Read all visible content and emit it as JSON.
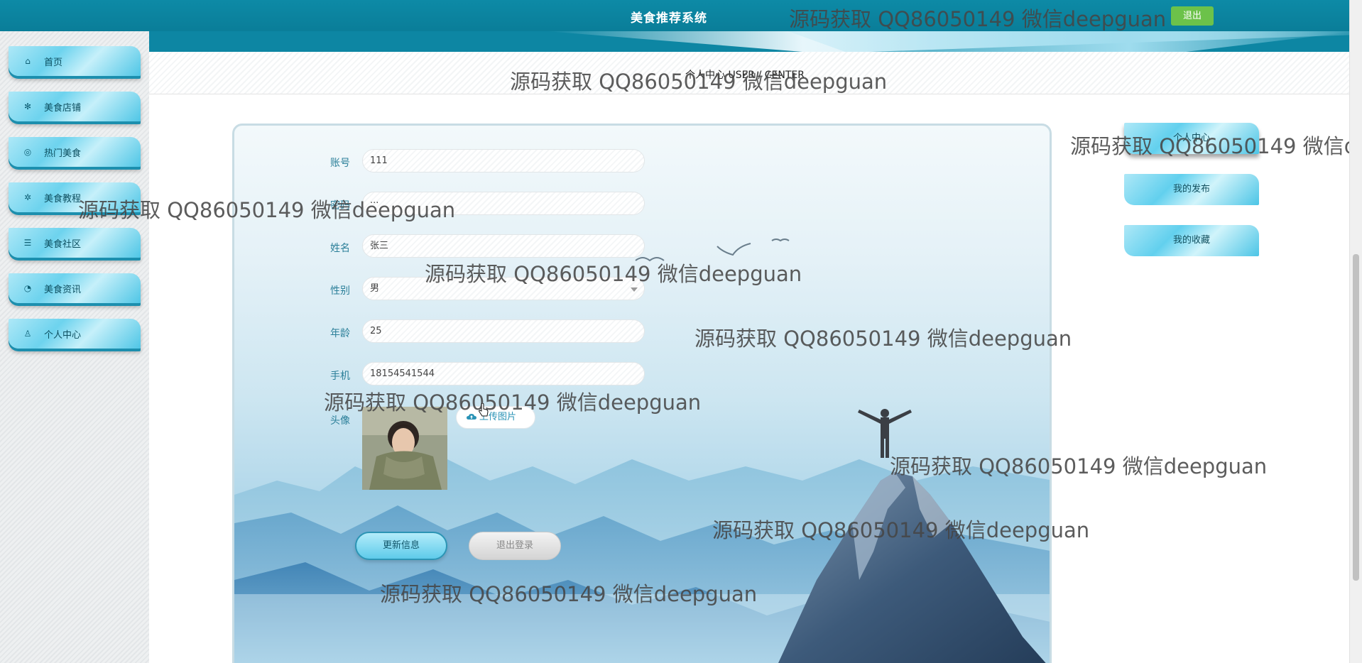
{
  "header": {
    "site_title": "美食推荐系统",
    "logout_label": "退出"
  },
  "sidebar": {
    "items": [
      {
        "label": "首页",
        "icon": "home-icon",
        "glyph": "⌂"
      },
      {
        "label": "美食店铺",
        "icon": "snowflake-icon",
        "glyph": "✻"
      },
      {
        "label": "热门美食",
        "icon": "globe-icon",
        "glyph": "◎"
      },
      {
        "label": "美食教程",
        "icon": "gear-icon",
        "glyph": "✲"
      },
      {
        "label": "美食社区",
        "icon": "sliders-icon",
        "glyph": "☰"
      },
      {
        "label": "美食资讯",
        "icon": "gauge-icon",
        "glyph": "◔"
      },
      {
        "label": "个人中心",
        "icon": "user-icon",
        "glyph": "♙"
      }
    ]
  },
  "breadcrumb": "个人中心 USER / CENTER",
  "form": {
    "account_label": "账号",
    "account_value": "111",
    "password_label": "密码",
    "password_value": "···",
    "name_label": "姓名",
    "name_value": "张三",
    "gender_label": "性别",
    "gender_value": "男",
    "age_label": "年龄",
    "age_value": "25",
    "phone_label": "手机",
    "phone_value": "18154541544",
    "avatar_label": "头像",
    "upload_label": "上传图片",
    "update_label": "更新信息",
    "logout_label": "退出登录"
  },
  "right_menu": {
    "items": [
      {
        "label": "个人中心"
      },
      {
        "label": "我的发布"
      },
      {
        "label": "我的收藏"
      }
    ]
  },
  "watermark": "源码获取 QQ86050149 微信deepguan",
  "colors": {
    "header": "#0d8aa6",
    "accent": "#5ecbea",
    "logout_green": "#6cc24a",
    "label_teal": "#2b7f99"
  }
}
